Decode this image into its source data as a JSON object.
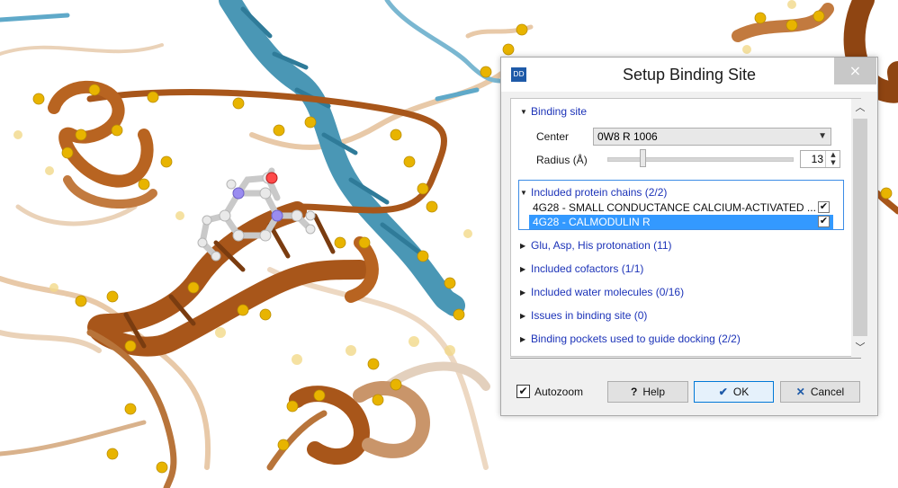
{
  "dialog": {
    "app_icon": "DD",
    "title": "Setup Binding Site",
    "close_icon": "×"
  },
  "binding_site": {
    "header": "Binding site",
    "center_label": "Center",
    "center_value": "0W8 R 1006",
    "radius_label": "Radius (Å)",
    "radius_value": "13"
  },
  "chains": {
    "header": "Included protein chains (2/2)",
    "rows": [
      {
        "label": "4G28 - SMALL CONDUCTANCE CALCIUM-ACTIVATED ...",
        "checked": true,
        "selected": false
      },
      {
        "label": "4G28 - CALMODULIN R",
        "checked": true,
        "selected": true
      }
    ]
  },
  "sections": [
    "Glu, Asp, His protonation (11)",
    "Included cofactors (1/1)",
    "Included water molecules (0/16)",
    "Issues in binding site (0)",
    "Binding pockets used to guide docking (2/2)"
  ],
  "footer": {
    "autozoom_label": "Autozoom",
    "help_label": "Help",
    "ok_label": "OK",
    "cancel_label": "Cancel"
  },
  "colors": {
    "accent": "#0078d7",
    "link": "#1c33b8",
    "selection": "#3399ff",
    "ribbon_orange": "#a8561a",
    "ribbon_blue": "#4a97b5",
    "dot_yellow": "#e8b400"
  }
}
